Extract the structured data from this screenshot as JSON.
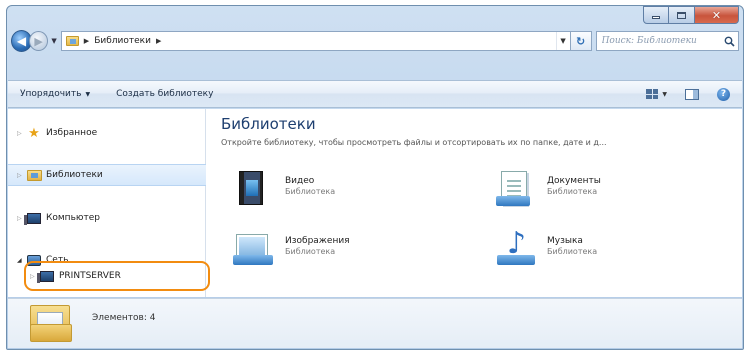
{
  "window": {
    "address": {
      "crumbs": [
        "Библиотеки"
      ],
      "folder_icon": "libraries-folder-icon"
    },
    "search": {
      "placeholder": "Поиск: Библиотеки"
    }
  },
  "commandbar": {
    "organize_label": "Упорядочить",
    "new_library_label": "Создать библиотеку"
  },
  "nav": {
    "items": [
      {
        "label": "Избранное",
        "icon": "star-icon"
      },
      {
        "label": "Библиотеки",
        "icon": "libraries-folder-icon",
        "selected": true
      },
      {
        "label": "Компьютер",
        "icon": "computer-icon"
      },
      {
        "label": "Сеть",
        "icon": "network-icon"
      },
      {
        "label": "PRINTSERVER",
        "icon": "server-computer-icon",
        "highlighted": true
      }
    ]
  },
  "main": {
    "title": "Библиотеки",
    "description": "Откройте библиотеку, чтобы просмотреть файлы и отсортировать их по папке, дате и д...",
    "libraries": [
      {
        "name": "Видео",
        "type": "Библиотека",
        "icon": "video-library-icon"
      },
      {
        "name": "Документы",
        "type": "Библиотека",
        "icon": "documents-library-icon"
      },
      {
        "name": "Изображения",
        "type": "Библиотека",
        "icon": "pictures-library-icon"
      },
      {
        "name": "Музыка",
        "type": "Библиотека",
        "icon": "music-library-icon"
      }
    ]
  },
  "details": {
    "item_count": "Элементов: 4"
  },
  "colors": {
    "highlight": "#f28c10",
    "title": "#1e3f70",
    "selection": "#d6e8fb"
  }
}
